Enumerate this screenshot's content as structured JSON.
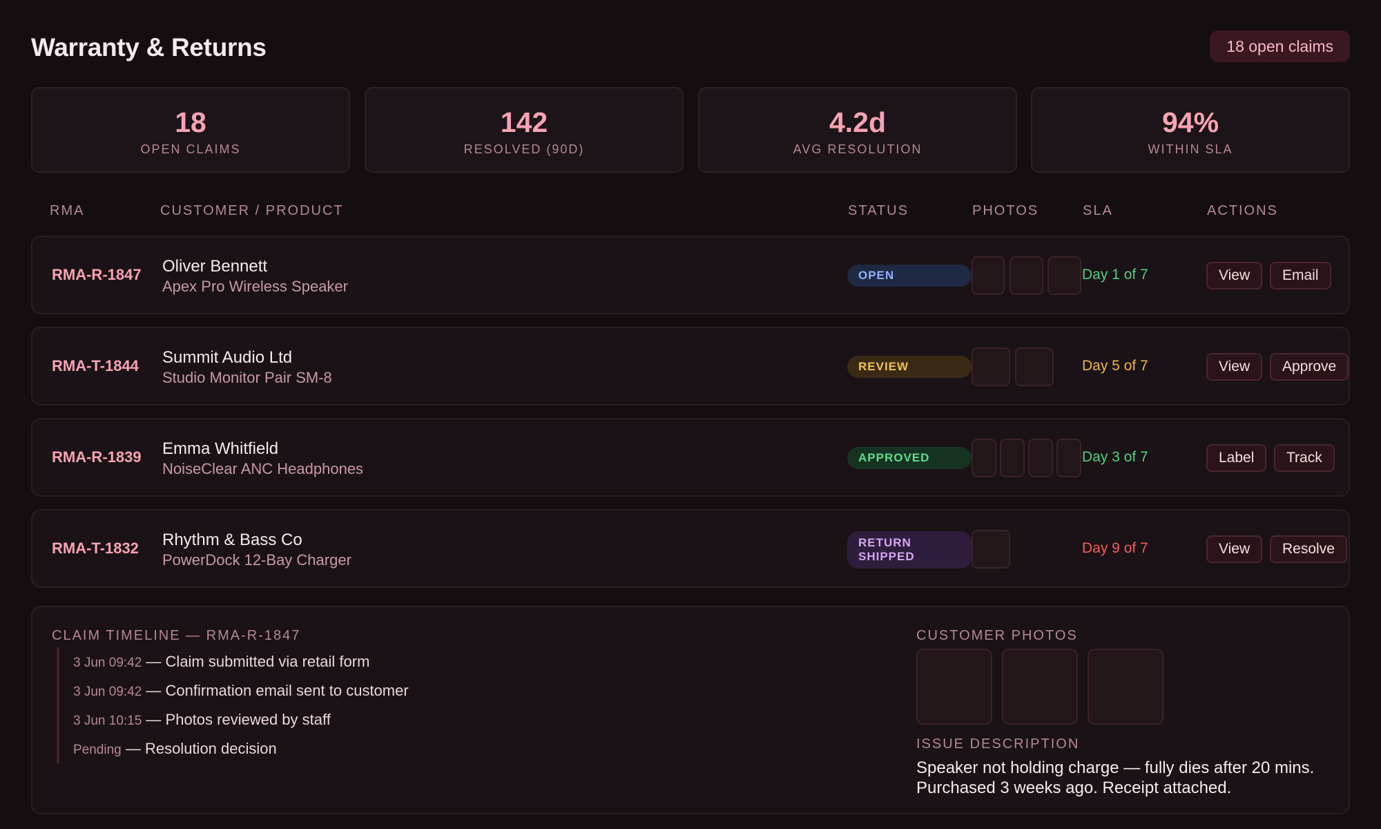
{
  "header": {
    "title": "Warranty & Returns",
    "open_pill": "18 open claims"
  },
  "stats": [
    {
      "value": "18",
      "label": "OPEN CLAIMS"
    },
    {
      "value": "142",
      "label": "RESOLVED (90D)"
    },
    {
      "value": "4.2d",
      "label": "AVG RESOLUTION"
    },
    {
      "value": "94%",
      "label": "WITHIN SLA"
    }
  ],
  "table": {
    "columns": [
      "RMA",
      "CUSTOMER / PRODUCT",
      "STATUS",
      "PHOTOS",
      "SLA",
      "ACTIONS"
    ],
    "rows": [
      {
        "rma": "RMA-R-1847",
        "customer": "Oliver Bennett",
        "product": "Apex Pro Wireless Speaker",
        "status_line1": "OPEN",
        "status_line2": "",
        "photos": 3,
        "sla": "Day 1 of 7",
        "sla_color": "#4fd17f",
        "actions": [
          "View",
          "Email"
        ]
      },
      {
        "rma": "RMA-T-1844",
        "customer": "Summit Audio Ltd",
        "product": "Studio Monitor Pair SM-8",
        "status_line1": "REVIEW",
        "status_line2": "",
        "photos": 2,
        "sla": "Day 5 of 7",
        "sla_color": "#f0b63e",
        "actions": [
          "View",
          "Approve"
        ]
      },
      {
        "rma": "RMA-R-1839",
        "customer": "Emma Whitfield",
        "product": "NoiseClear ANC Headphones",
        "status_line1": "APPROVED",
        "status_line2": "",
        "photos": 4,
        "sla": "Day 3 of 7",
        "sla_color": "#4fd17f",
        "actions": [
          "Label",
          "Track"
        ]
      },
      {
        "rma": "RMA-T-1832",
        "customer": "Rhythm & Bass Co",
        "product": "PowerDock 12-Bay Charger",
        "status_line1": "RETURN",
        "status_line2": "SHIPPED",
        "photos": 1,
        "sla": "Day 9 of 7",
        "sla_color": "#f25f5c",
        "actions": [
          "View",
          "Resolve"
        ]
      }
    ]
  },
  "detail": {
    "timeline_title": "CLAIM TIMELINE — RMA-R-1847",
    "timeline": [
      {
        "time": "3 Jun 09:42",
        "text": " — Claim submitted via retail form"
      },
      {
        "time": "3 Jun 09:42",
        "text": " — Confirmation email sent to customer"
      },
      {
        "time": "3 Jun 10:15",
        "text": " — Photos reviewed by staff"
      },
      {
        "time": "Pending",
        "text": " — Resolution decision"
      }
    ],
    "photos_title": "CUSTOMER PHOTOS",
    "issue_title": "ISSUE DESCRIPTION",
    "issue_text": "Speaker not holding charge — fully dies after 20 mins. Purchased 3 weeks ago. Receipt attached."
  }
}
